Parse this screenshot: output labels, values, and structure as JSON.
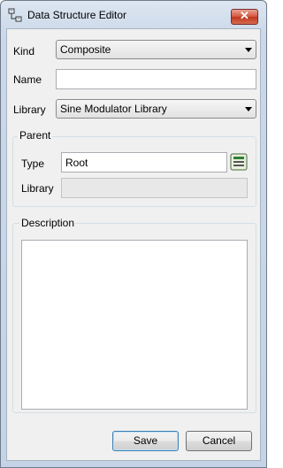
{
  "window": {
    "title": "Data Structure Editor",
    "close_glyph": "✕"
  },
  "form": {
    "kind_label": "Kind",
    "kind_value": "Composite",
    "name_label": "Name",
    "name_value": "",
    "library_label": "Library",
    "library_value": "Sine Modulator Library"
  },
  "parent": {
    "group_title": "Parent",
    "type_label": "Type",
    "type_value": "Root",
    "library_label": "Library",
    "library_value": ""
  },
  "description": {
    "group_title": "Description",
    "value": ""
  },
  "buttons": {
    "save": "Save",
    "cancel": "Cancel"
  },
  "icons": {
    "title": "data-structure-icon",
    "picker": "type-picker-icon"
  }
}
